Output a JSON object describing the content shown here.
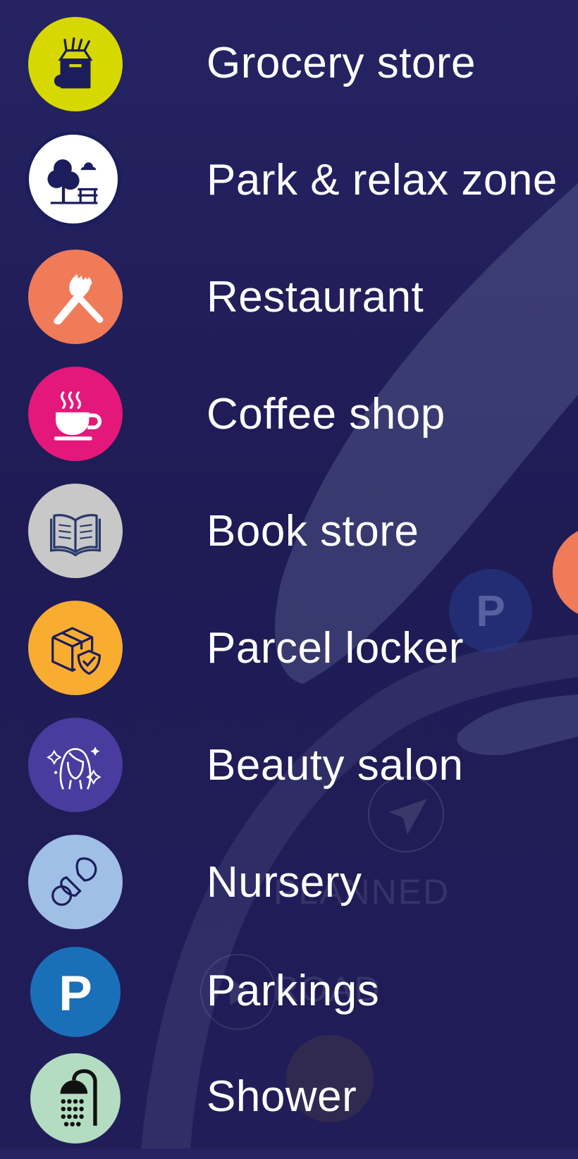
{
  "legend": {
    "items": [
      {
        "label": "Grocery store",
        "icon": "grocery-bag-icon",
        "color": "#d6d800"
      },
      {
        "label": "Park & relax zone",
        "icon": "park-tree-bench-icon",
        "color": "#ffffff"
      },
      {
        "label": "Restaurant",
        "icon": "knife-fork-icon",
        "color": "#ef7b58"
      },
      {
        "label": "Coffee shop",
        "icon": "coffee-cup-icon",
        "color": "#e3187a"
      },
      {
        "label": "Book store",
        "icon": "open-book-icon",
        "color": "#c8c8c8"
      },
      {
        "label": "Parcel locker",
        "icon": "parcel-shield-icon",
        "color": "#f8ad30"
      },
      {
        "label": "Beauty salon",
        "icon": "woman-face-sparkle-icon",
        "color": "#493c9e"
      },
      {
        "label": "Nursery",
        "icon": "pacifier-icon",
        "color": "#9fbfe6"
      },
      {
        "label": "Parkings",
        "icon": "parking-p-icon",
        "color": "#1a70b8"
      },
      {
        "label": "Shower",
        "icon": "shower-icon",
        "color": "#b4dcc1"
      }
    ]
  },
  "background": {
    "planned_text": "PLANNED",
    "road_text": "ROAD",
    "parking_marker_letter": "P"
  }
}
